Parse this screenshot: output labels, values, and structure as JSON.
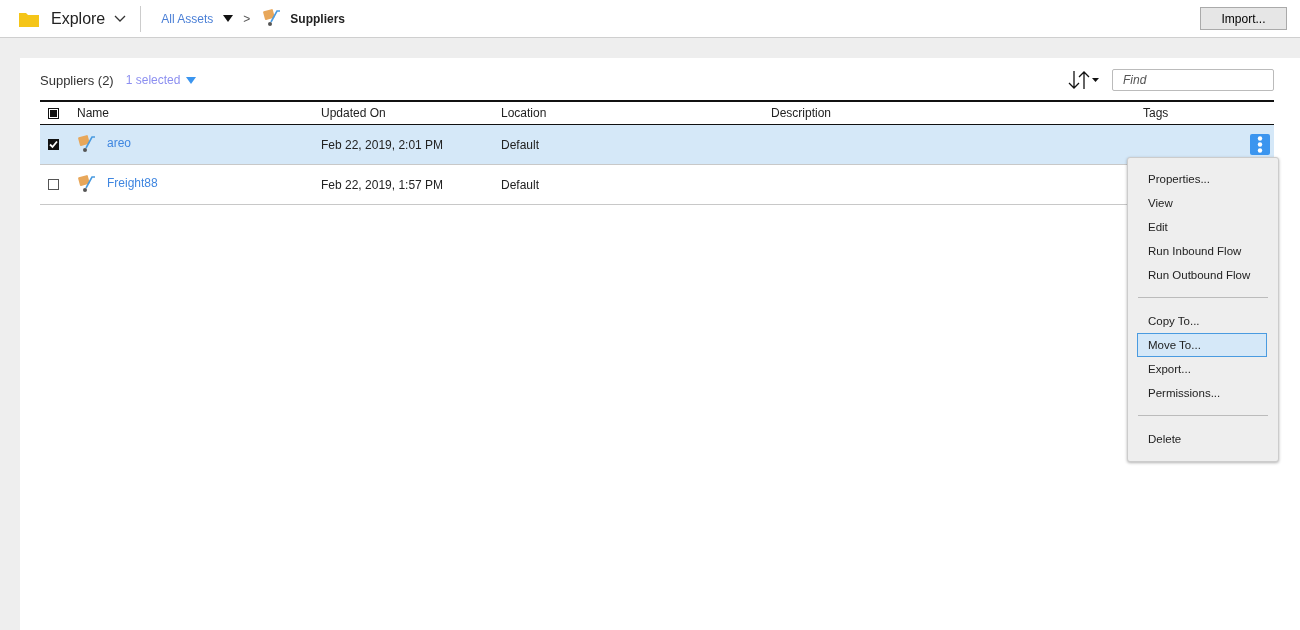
{
  "top_bar": {
    "app_title": "Explore",
    "breadcrumb": {
      "root": "All Assets",
      "separator": ">",
      "current": "Suppliers"
    },
    "import_button": "Import..."
  },
  "list": {
    "title": "Suppliers (2)",
    "selection_label": "1 selected",
    "search": {
      "placeholder": "Find"
    },
    "columns": [
      "Name",
      "Updated On",
      "Location",
      "Description",
      "Tags"
    ],
    "select_all": {
      "indeterminate": true
    },
    "rows": [
      {
        "name": "areo",
        "updated_on": "Feb 22, 2019, 2:01 PM",
        "location": "Default",
        "checked": true,
        "selected": true
      },
      {
        "name": "Freight88",
        "updated_on": "Feb 22, 2019, 1:57 PM",
        "location": "Default",
        "checked": false,
        "selected": false
      }
    ]
  },
  "context_menu": {
    "groups": [
      [
        {
          "label": "Properties...",
          "selected": false
        },
        {
          "label": "View",
          "selected": false
        },
        {
          "label": "Edit",
          "selected": false
        },
        {
          "label": "Run Inbound Flow",
          "selected": false
        },
        {
          "label": "Run Outbound Flow",
          "selected": false
        }
      ],
      [
        {
          "label": "Copy To...",
          "selected": false
        },
        {
          "label": "Move To...",
          "selected": true
        },
        {
          "label": "Export...",
          "selected": false
        },
        {
          "label": "Permissions...",
          "selected": false
        }
      ],
      [
        {
          "label": "Delete",
          "selected": false
        }
      ]
    ]
  }
}
